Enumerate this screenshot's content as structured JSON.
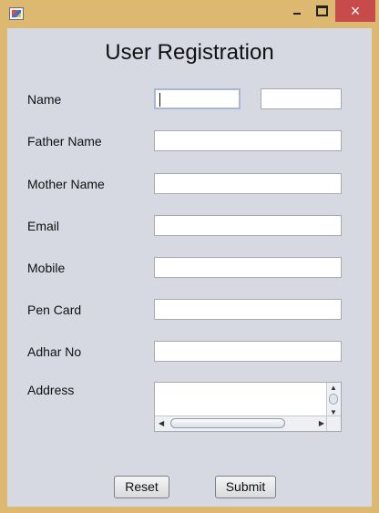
{
  "window": {
    "app_icon": "java-icon",
    "controls": {
      "minimize_icon": "minimize-icon",
      "maximize_icon": "maximize-icon",
      "close_icon": "close-icon",
      "close_text": "×"
    }
  },
  "form": {
    "title": "User Registration",
    "labels": {
      "name": "Name",
      "father_name": "Father Name",
      "mother_name": "Mother Name",
      "email": "Email",
      "mobile": "Mobile",
      "pen_card": "Pen Card",
      "adhar_no": "Adhar No",
      "address": "Address"
    },
    "fields": {
      "first_name": "",
      "last_name": "",
      "father_name": "",
      "mother_name": "",
      "email": "",
      "mobile": "",
      "pen_card": "",
      "adhar_no": "",
      "address": ""
    },
    "buttons": {
      "reset": "Reset",
      "submit": "Submit"
    }
  },
  "colors": {
    "titlebar": "#dcb870",
    "panel": "#d7d9e2",
    "close": "#c74b4b"
  }
}
